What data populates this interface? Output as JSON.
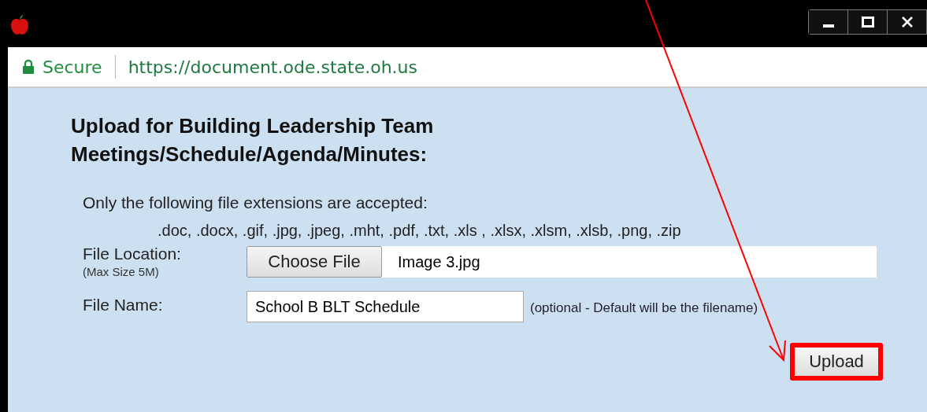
{
  "address_bar": {
    "security": "Secure",
    "url": "https://document.ode.state.oh.us"
  },
  "heading": [
    "Upload for Building Leadership Team",
    "Meetings/Schedule/Agenda/Minutes:"
  ],
  "accepted_note": "Only the following file extensions are accepted:",
  "extensions": ".doc, .docx, .gif, .jpg, .jpeg, .mht, .pdf, .txt, .xls , .xlsx, .xlsm, .xlsb, .png, .zip",
  "file_location": {
    "label": "File Location:",
    "hint": "(Max Size 5M)",
    "button": "Choose File",
    "value": "Image 3.jpg"
  },
  "file_name": {
    "label": "File Name:",
    "value": "School B BLT Schedule",
    "hint": "(optional - Default will be the filename)"
  },
  "upload_button": {
    "label": "Upload",
    "highlighted": true
  }
}
